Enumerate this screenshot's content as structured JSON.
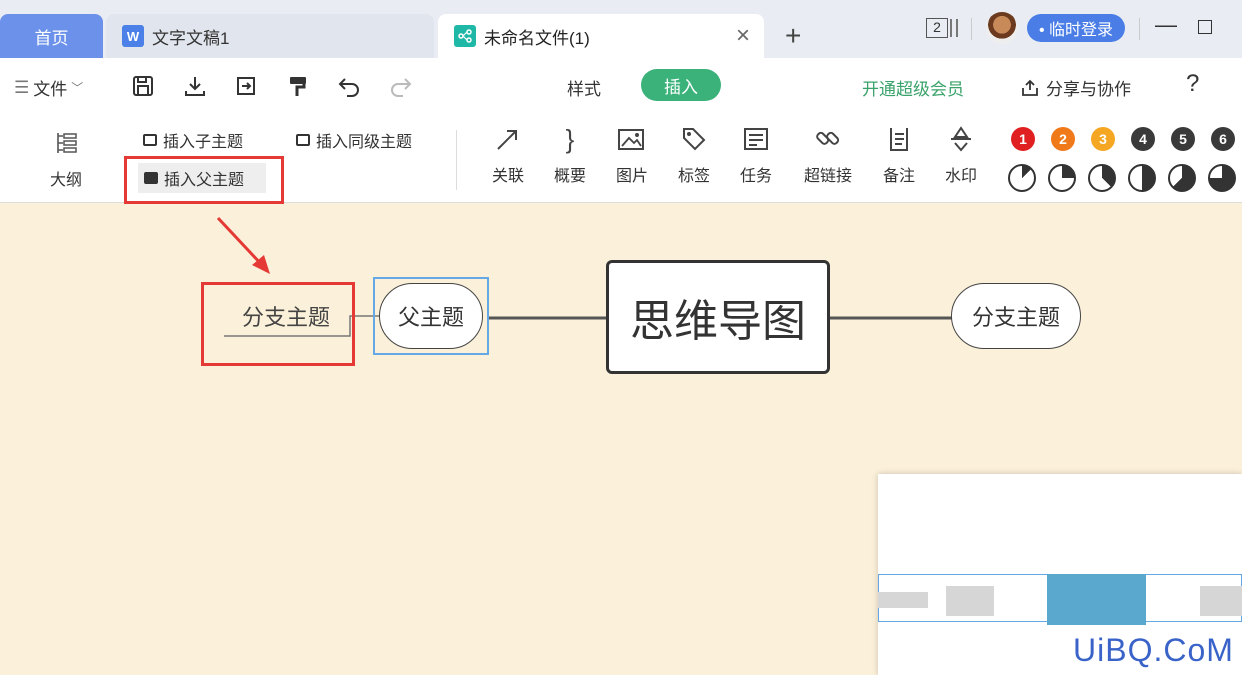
{
  "tabs": {
    "home": "首页",
    "doc": "文字文稿1",
    "mind": "未命名文件(1)",
    "doc_icon": "W"
  },
  "titlebar": {
    "tab_count": "2",
    "login": "• 临时登录"
  },
  "toolbar": {
    "file": "文件",
    "style_tab": "样式",
    "insert_tab": "插入",
    "vip": "开通超级会员",
    "share": "分享与协作",
    "help": "?"
  },
  "ribbon": {
    "outline": "大纲",
    "insert_child": "插入子主题",
    "insert_sibling": "插入同级主题",
    "insert_parent": "插入父主题",
    "relation": "关联",
    "summary": "概要",
    "image": "图片",
    "tag": "标签",
    "task": "任务",
    "hyperlink": "超链接",
    "note": "备注",
    "watermark": "水印",
    "priorities": [
      "1",
      "2",
      "3",
      "4",
      "5",
      "6"
    ],
    "priority_colors": [
      "#e02020",
      "#f07a1a",
      "#f5a623",
      "#3a3a3a",
      "#3a3a3a",
      "#3a3a3a"
    ],
    "progress_levels": [
      0.125,
      0.25,
      0.375,
      0.5,
      0.625,
      0.75
    ]
  },
  "mindmap": {
    "central": "思维导图",
    "left_branch": "分支主题",
    "parent": "父主题",
    "right_branch": "分支主题"
  },
  "watermark_text": "UiBQ.CoM"
}
